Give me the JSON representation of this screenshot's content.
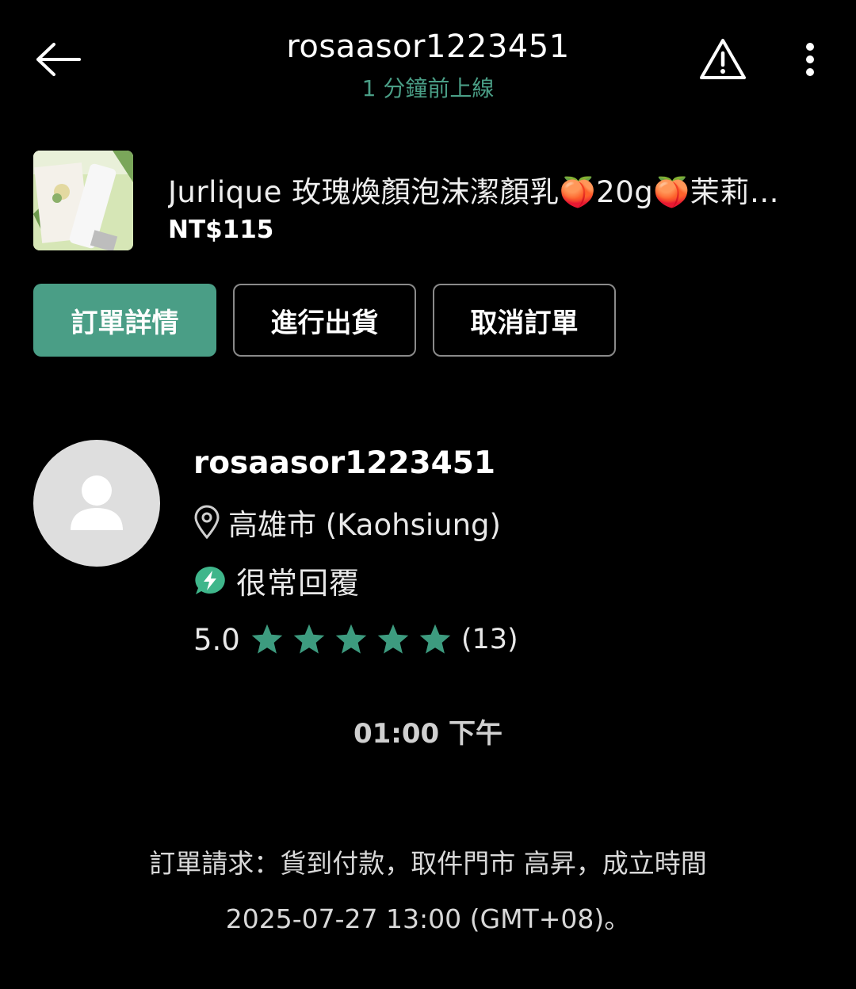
{
  "header": {
    "username": "rosaasor1223451",
    "status": "1 分鐘前上線",
    "back_icon": "arrow-left-icon",
    "report_icon": "warning-icon",
    "more_icon": "more-vertical-icon"
  },
  "product": {
    "title": "Jurlique 玫瑰煥顏泡沫潔顏乳🍑20g🍑茉莉…",
    "price": "NT$115"
  },
  "actions": {
    "order_details": "訂單詳情",
    "ship": "進行出貨",
    "cancel": "取消訂單"
  },
  "profile": {
    "name": "rosaasor1223451",
    "location": "高雄市 (Kaohsiung)",
    "response": "很常回覆",
    "rating": "5.0",
    "stars": 5,
    "review_count": "(13)"
  },
  "message": {
    "time": "01:00 下午",
    "system_line1": "訂單請求：貨到付款，取件門市 高昇，成立時間",
    "system_line2": "2025-07-27 13:00 (GMT+08)。"
  },
  "colors": {
    "accent": "#4a9e86",
    "background": "#000000"
  }
}
